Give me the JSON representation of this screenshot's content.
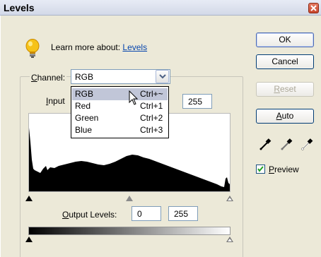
{
  "window": {
    "title": "Levels"
  },
  "learn": {
    "prefix": "Learn more about:",
    "link": "Levels"
  },
  "channel": {
    "label": "Channel:",
    "label_mnemonic": "C",
    "label_rest": "hannel:",
    "value": "RGB"
  },
  "input": {
    "label": "Input",
    "label_mnemonic": "I",
    "label_rest": "nput",
    "white": "255"
  },
  "menu": {
    "items": [
      {
        "label": "RGB",
        "shortcut": "Ctrl+~",
        "selected": true
      },
      {
        "label": "Red",
        "shortcut": "Ctrl+1",
        "selected": false
      },
      {
        "label": "Green",
        "shortcut": "Ctrl+2",
        "selected": false
      },
      {
        "label": "Blue",
        "shortcut": "Ctrl+3",
        "selected": false
      }
    ]
  },
  "output": {
    "label": "Output Levels:",
    "label_mnemonic": "O",
    "label_rest": "utput Levels:",
    "black": "0",
    "white": "255"
  },
  "buttons": {
    "ok": "OK",
    "cancel": "Cancel",
    "reset": "Reset",
    "reset_mnemonic": "R",
    "reset_rest": "eset",
    "auto": "Auto",
    "auto_mnemonic": "A",
    "auto_rest": "uto"
  },
  "preview": {
    "label": "Preview",
    "label_mnemonic": "P",
    "label_rest": "review",
    "checked": true
  },
  "icons": [
    "lightbulb-icon",
    "close-icon",
    "chevron-down-icon",
    "black-eyedropper-icon",
    "gray-eyedropper-icon",
    "white-eyedropper-icon",
    "arrow-cursor-icon"
  ]
}
